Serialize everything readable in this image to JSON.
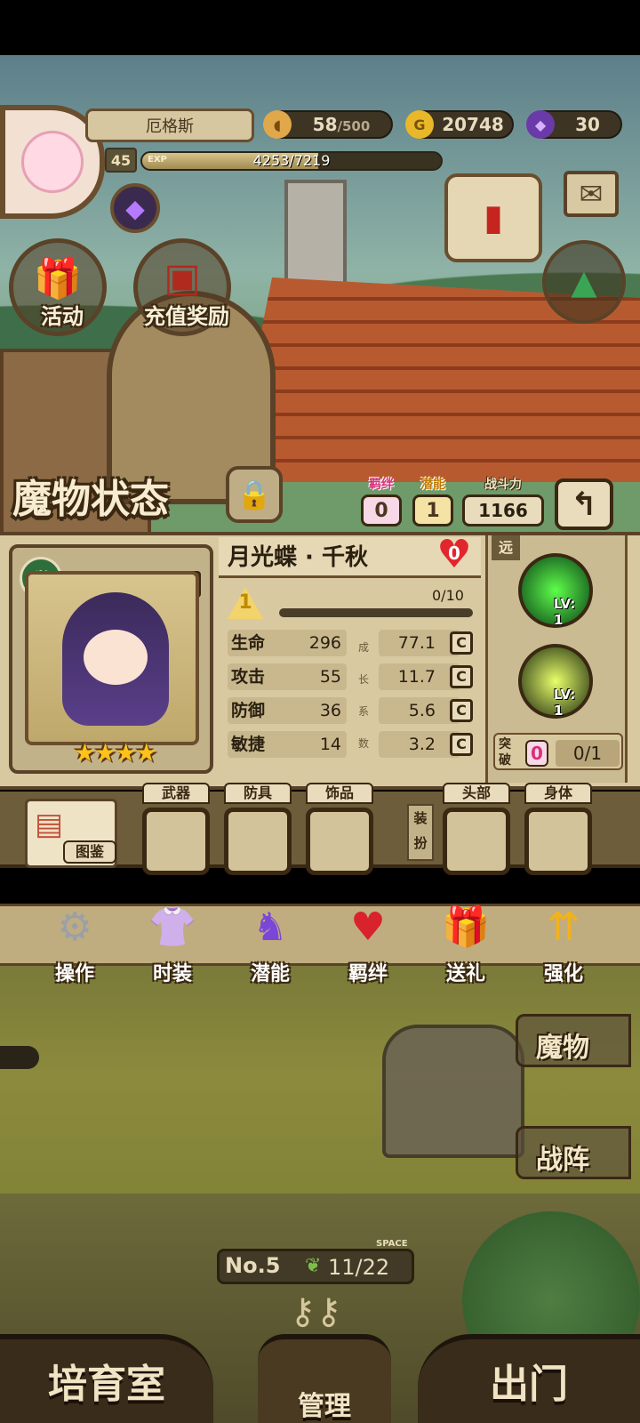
{
  "player": {
    "name": "厄格斯",
    "level": "45",
    "exp_label": "EXP",
    "exp_text": "4253/7219",
    "exp_fraction": 0.589
  },
  "resources": {
    "stamina": "58",
    "stamina_max": "/500",
    "gold": "20748",
    "gems": "30"
  },
  "quick_buttons": {
    "event": "活动",
    "topup": "充值奖励"
  },
  "panel": {
    "title": "魔物状态",
    "bond_label": "羁绊",
    "bond_value": "0",
    "potential_label": "潜能",
    "potential_value": "1",
    "power_label": "战斗力",
    "power_value": "1166",
    "back_glyph": "↰"
  },
  "monster": {
    "name": "月光蝶 · 千秋",
    "rank": "C",
    "heart": "0",
    "stars": "★★★★",
    "level": "1",
    "level_progress": "0/10",
    "range": "远",
    "growth_label": "成长系数",
    "stats": [
      {
        "name": "生命",
        "value": "296",
        "growth": "77.1",
        "grade": "C"
      },
      {
        "name": "攻击",
        "value": "55",
        "growth": "11.7",
        "grade": "C"
      },
      {
        "name": "防御",
        "value": "36",
        "growth": "5.6",
        "grade": "C"
      },
      {
        "name": "敏捷",
        "value": "14",
        "growth": "3.2",
        "grade": "C"
      }
    ],
    "skills": [
      {
        "level": "LV: 1"
      },
      {
        "level": "LV: 1"
      }
    ],
    "break_label": "突破",
    "break_count": "0",
    "break_progress": "0/1"
  },
  "equipment": {
    "handbook": "图鉴",
    "slots": [
      "武器",
      "防具",
      "饰品",
      "头部",
      "身体"
    ],
    "dress_label": "装扮"
  },
  "actions": [
    {
      "label": "操作",
      "icon": "gear-icon"
    },
    {
      "label": "时装",
      "icon": "outfit-icon"
    },
    {
      "label": "潜能",
      "icon": "potential-icon"
    },
    {
      "label": "羁绊",
      "icon": "bond-hearts-icon"
    },
    {
      "label": "送礼",
      "icon": "gift-icon"
    },
    {
      "label": "强化",
      "icon": "upgrade-arrows-icon"
    }
  ],
  "side_nav": {
    "monsters": "魔物",
    "formation": "战阵"
  },
  "counter": {
    "no_prefix": "No.",
    "no_value": "5",
    "space_label": "SPACE",
    "space_value": "11/22"
  },
  "bottom_nav": {
    "nursery": "培育室",
    "manage": "管理",
    "out": "出门"
  },
  "colors": {
    "panel_bg": "#d9c9a0",
    "frame_dark": "#3a2812",
    "bond_pink": "#d7317a",
    "heart_red": "#e1262e",
    "star_gold": "#ffc21a"
  }
}
